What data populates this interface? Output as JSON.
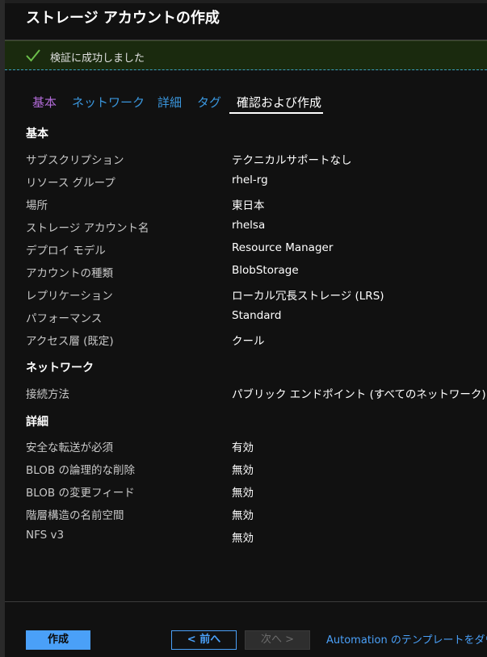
{
  "title": "ストレージ アカウントの作成",
  "banner": {
    "icon": "checkmark-icon",
    "text": "検証に成功しました",
    "color": "#6cc04a"
  },
  "tabs": [
    {
      "label": "基本",
      "state": "visited"
    },
    {
      "label": "ネットワーク",
      "state": "link"
    },
    {
      "label": "詳細",
      "state": "link"
    },
    {
      "label": "タグ",
      "state": "link"
    },
    {
      "label": "確認および作成",
      "state": "active"
    }
  ],
  "sections": {
    "basics": {
      "heading": "基本",
      "rows": [
        {
          "label": "サブスクリプション",
          "value": "テクニカルサポートなし"
        },
        {
          "label": "リソース グループ",
          "value": "rhel-rg"
        },
        {
          "label": "場所",
          "value": "東日本"
        },
        {
          "label": "ストレージ アカウント名",
          "value": "rhelsa"
        },
        {
          "label": "デプロイ モデル",
          "value": "Resource Manager"
        },
        {
          "label": "アカウントの種類",
          "value": "BlobStorage"
        },
        {
          "label": "レプリケーション",
          "value": "ローカル冗長ストレージ (LRS)"
        },
        {
          "label": "パフォーマンス",
          "value": "Standard"
        },
        {
          "label": "アクセス層 (既定)",
          "value": "クール"
        }
      ]
    },
    "network": {
      "heading": "ネットワーク",
      "rows": [
        {
          "label": "接続方法",
          "value": "パブリック エンドポイント (すべてのネットワーク)"
        }
      ]
    },
    "advanced": {
      "heading": "詳細",
      "rows": [
        {
          "label": "安全な転送が必須",
          "value": "有効"
        },
        {
          "label": "BLOB の論理的な削除",
          "value": "無効"
        },
        {
          "label": "BLOB の変更フィード",
          "value": "無効"
        },
        {
          "label": "階層構造の名前空間",
          "value": "無効"
        },
        {
          "label": "NFS v3",
          "value": "無効"
        }
      ]
    }
  },
  "footer": {
    "create_label": "作成",
    "prev_label": "< 前へ",
    "next_label": "次へ >",
    "automation_link": "Automation のテンプレートをダウ"
  },
  "colors": {
    "accent": "#4aa0f8",
    "background": "#111111",
    "visited_tab": "#b06ad6"
  }
}
